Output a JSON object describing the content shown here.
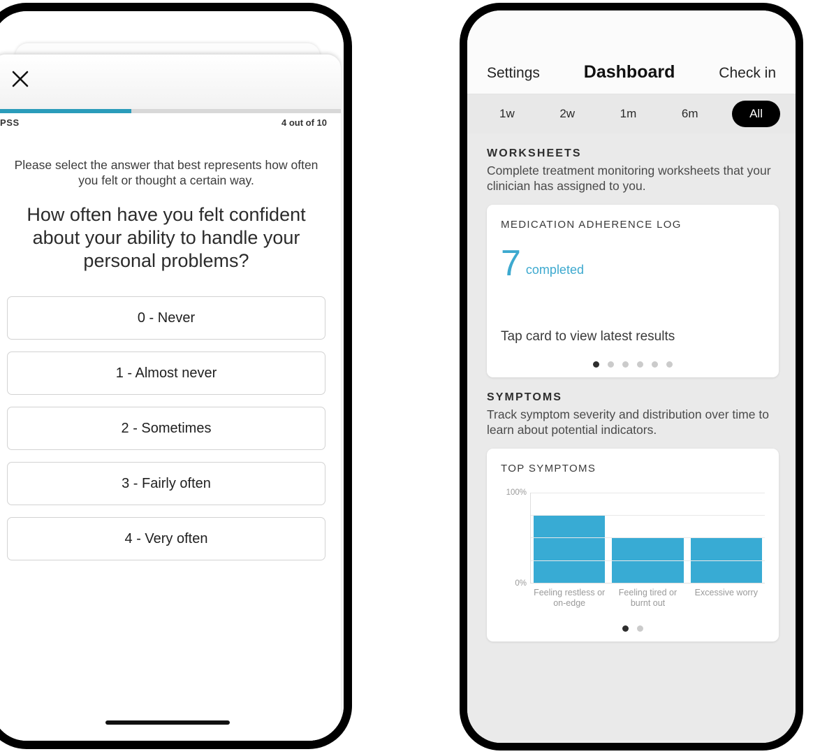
{
  "left_phone": {
    "survey": {
      "close_icon": "close-x-icon",
      "progress_percent": 40,
      "scale_label": "PSS",
      "progress_text": "4 out of 10",
      "instruction": "Please select the answer that best represents how often you felt or thought a certain way.",
      "question": "How often have you felt confident about your ability to handle your personal problems?",
      "options": [
        "0 - Never",
        "1 - Almost never",
        "2 - Sometimes",
        "3 - Fairly often",
        "4 - Very often"
      ],
      "accent_color": "#2a9cba"
    }
  },
  "right_phone": {
    "navbar": {
      "left_action": "Settings",
      "title": "Dashboard",
      "right_action": "Check in"
    },
    "filters": {
      "options": [
        "1w",
        "2w",
        "1m",
        "6m",
        "All"
      ],
      "selected": "All"
    },
    "sections": [
      {
        "title": "WORKSHEETS",
        "description": "Complete treatment monitoring worksheets that your clinician has assigned to you."
      },
      {
        "title": "SYMPTOMS",
        "description": "Track symptom severity and distribution over time to learn about potential indicators."
      }
    ],
    "worksheet_card": {
      "title": "MEDICATION ADHERENCE LOG",
      "stat_value": "7",
      "stat_label": "completed",
      "hint": "Tap card to view latest results",
      "pager_total": 6,
      "pager_active": 1,
      "accent_color": "#3da9cf"
    },
    "symptom_card": {
      "title": "TOP SYMPTOMS",
      "pager_total": 2,
      "pager_active": 1
    }
  },
  "chart_data": {
    "type": "bar",
    "title": "TOP SYMPTOMS",
    "categories": [
      "Feeling restless or on-edge",
      "Feeling tired or burnt out",
      "Excessive worry"
    ],
    "values": [
      75,
      50,
      50
    ],
    "xlabel": "",
    "ylabel": "",
    "ylim": [
      0,
      100
    ],
    "ytick_labels": [
      "0%",
      "100%"
    ],
    "yticks": [
      0,
      25,
      50,
      75,
      100
    ],
    "grid": true,
    "legend": "none",
    "bar_color": "#38abd4"
  }
}
